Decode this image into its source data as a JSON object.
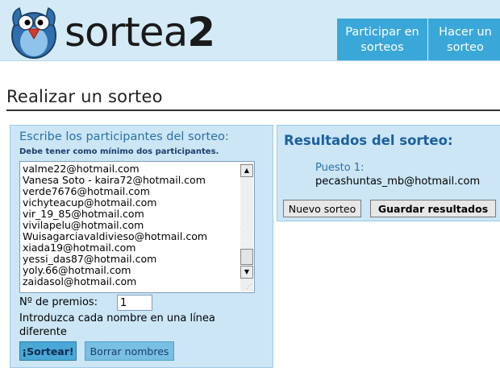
{
  "brand": {
    "name": "sortea",
    "suffix": "2"
  },
  "nav": {
    "items": [
      {
        "line1": "Participar en",
        "line2": "sorteos"
      },
      {
        "line1": "Hacer un",
        "line2": "sorteo"
      }
    ]
  },
  "page": {
    "title": "Realizar un sorteo"
  },
  "participants": {
    "heading": "Escribe los participantes del sorteo:",
    "subheading": "Debe tener como mínimo dos participantes.",
    "lines": [
      "valme22@hotmail.com",
      "Vanesa Soto - kaira72@hotmail.com",
      "verde7676@hotmail.com",
      "vichyteacup@hotmail.com",
      "vir_19_85@hotmail.com",
      "vivilapelu@hotmail.com",
      "Wuisagarciavaldivieso@hotmail.com",
      "xiada19@hotmail.com",
      "yessi_das87@hotmail.com",
      "yoly.66@hotmail.com",
      "zaidasol@hotmail.com"
    ],
    "prizes_label": "Nº de premios:",
    "prizes_value": "1",
    "hint": "Introduzca cada nombre en una línea diferente",
    "sortear_label": "¡Sortear!",
    "borrar_label": "Borrar nombres"
  },
  "results": {
    "heading": "Resultados del sorteo:",
    "place_label": "Puesto 1:",
    "winner": "pecashuntas_mb@hotmail.com",
    "nuevo_label": "Nuevo sorteo",
    "guardar_label": "Guardar resultados"
  },
  "colors": {
    "header_bg": "#d4ebf7",
    "nav_bg": "#3aa7d9",
    "panel_bg": "#cce6f6",
    "heading_blue": "#2c6fa6"
  },
  "icons": {
    "logo": "penguin-mascot-icon",
    "scroll_up": "arrow-up-icon",
    "scroll_down": "arrow-down-icon",
    "resize": "resize-grip-icon"
  }
}
